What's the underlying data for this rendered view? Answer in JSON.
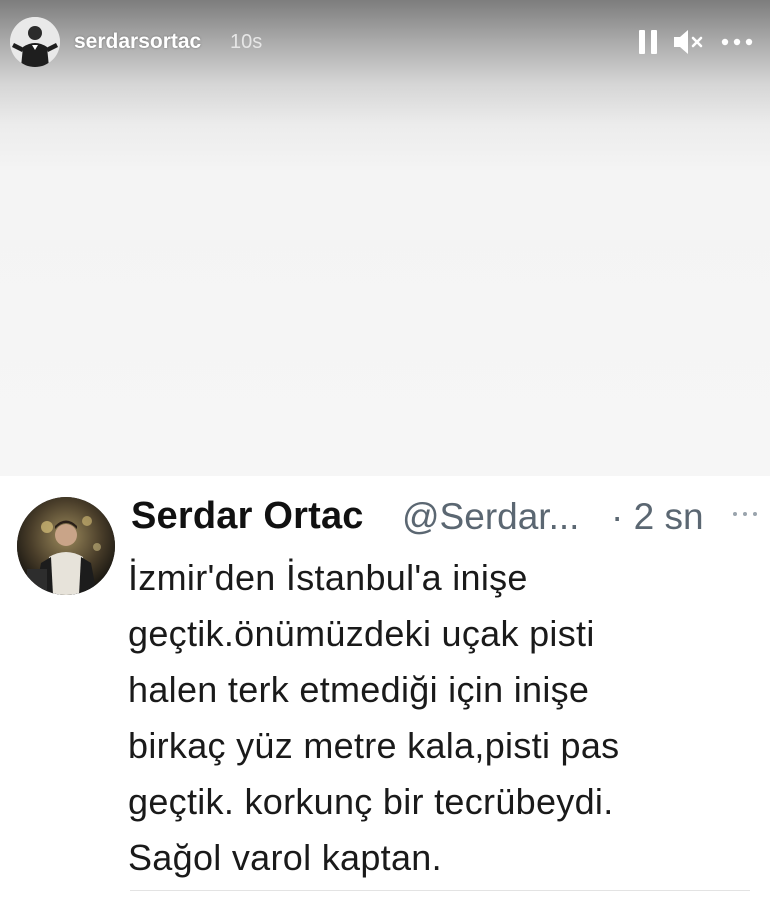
{
  "story": {
    "username": "serdarsortac",
    "time_ago": "10s",
    "avatar_icon": "profile-photo",
    "controls": {
      "pause_icon": "pause-icon",
      "mute_icon": "mute-icon",
      "more_icon": "more-horizontal-icon"
    }
  },
  "tweet": {
    "display_name": "Serdar Ortac",
    "handle": "@Serdar...",
    "time": "· 2 sn",
    "avatar_icon": "profile-photo",
    "more_icon": "more-horizontal-icon",
    "text": "İzmir'den İstanbul'a inişe\ngeçtik.önümüzdeki uçak pisti\nhalen terk etmediği için inişe\nbirkaç yüz metre kala,pisti pas\ngeçtik. korkunç bir tecrübeydi.\nSağol varol kaptan."
  },
  "colors": {
    "story_gradient_top": "#7d7d7d",
    "story_background": "#f6f6f6",
    "card_background": "#ffffff",
    "muted_text": "#5b6772"
  }
}
